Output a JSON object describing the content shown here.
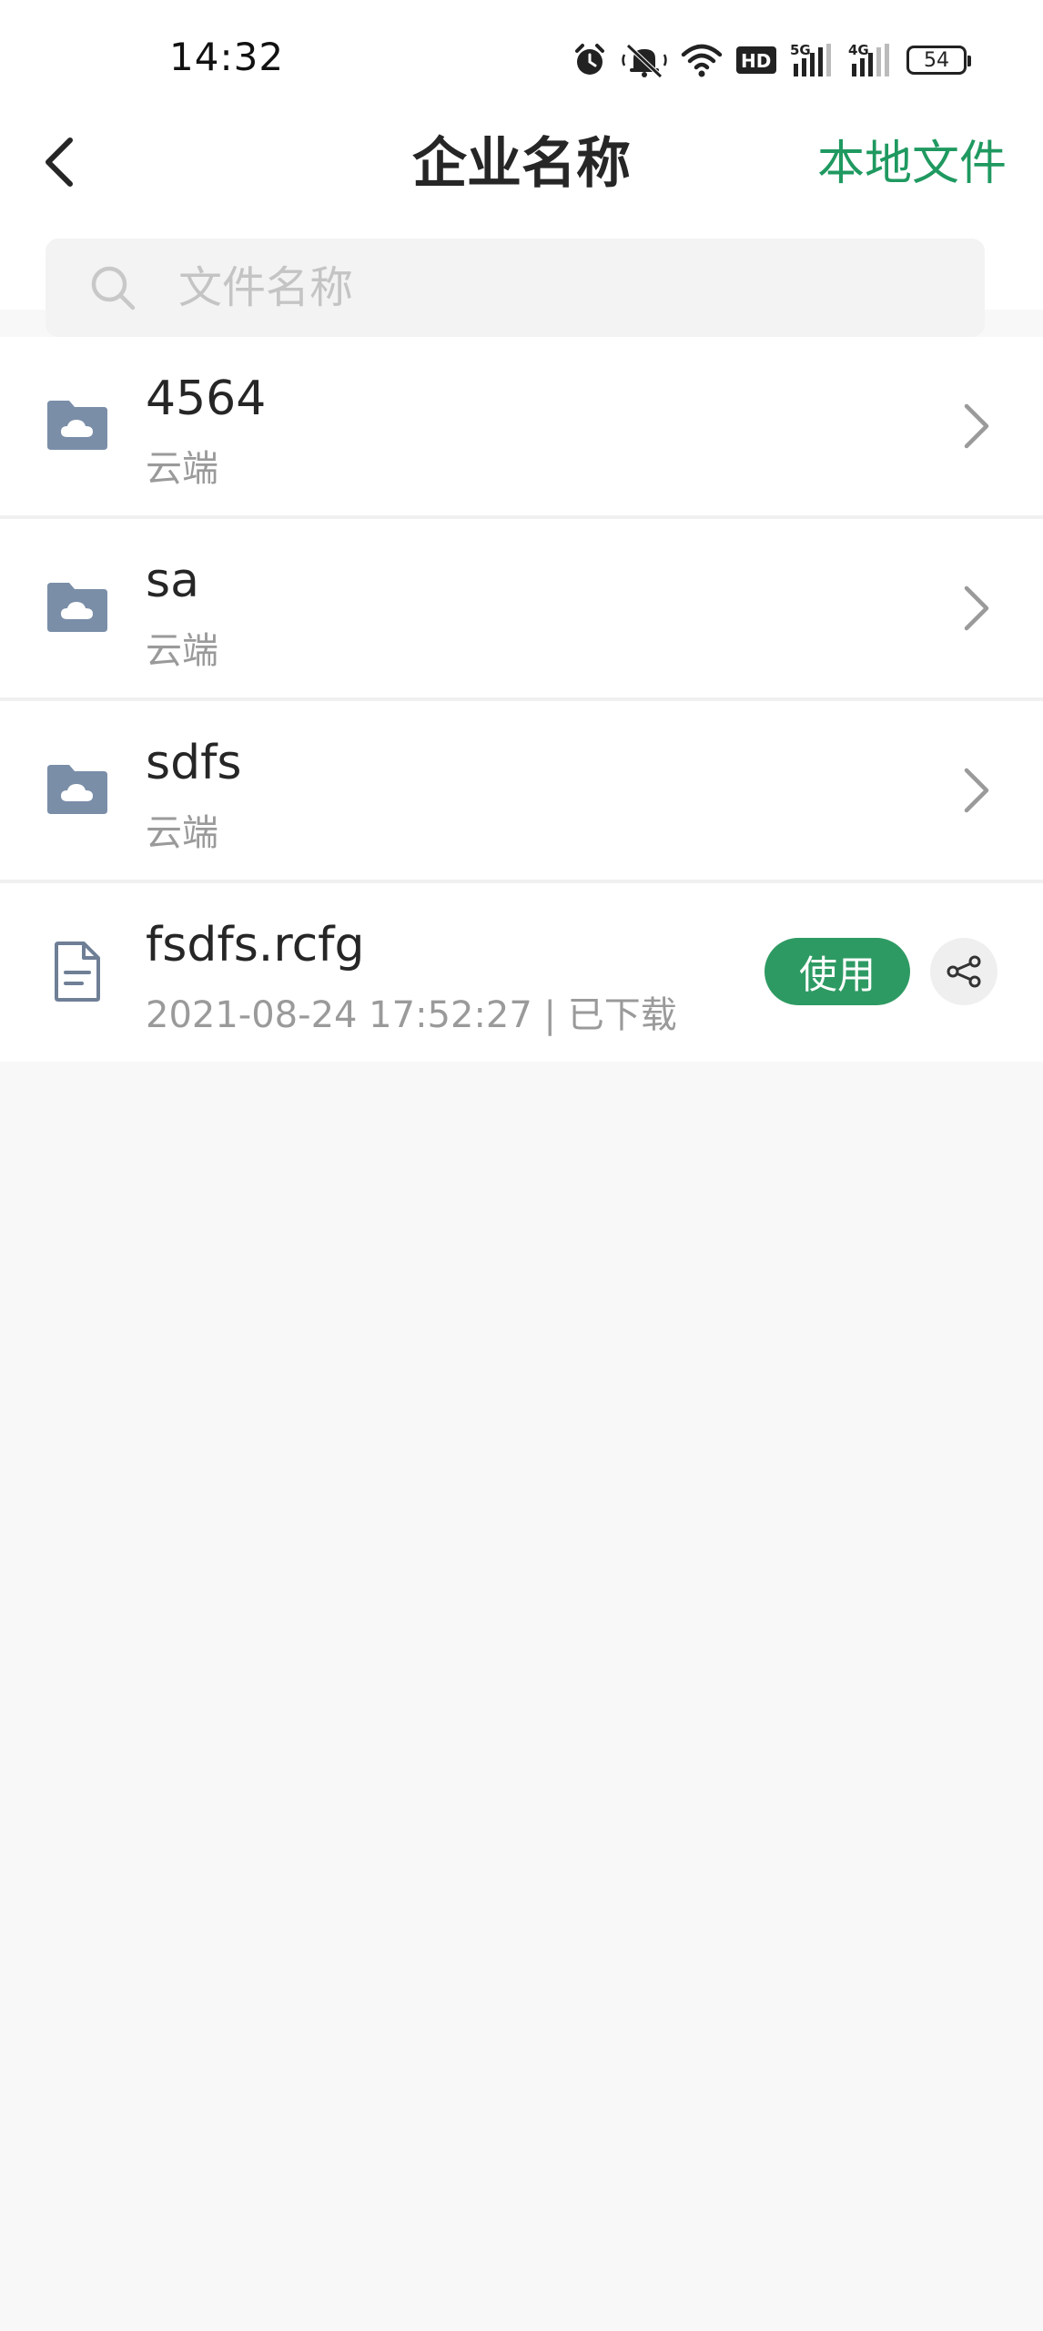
{
  "status_bar": {
    "time": "14:32",
    "icons": [
      "alarm-icon",
      "mute-icon",
      "wifi-icon",
      "hd-icon",
      "signal-5g-icon",
      "signal-4g-icon"
    ],
    "hd_label": "HD",
    "signal_5g_label": "5G",
    "signal_4g_label": "4G",
    "battery": "54"
  },
  "header": {
    "title": "企业名称",
    "local_files_label": "本地文件",
    "back_icon": "chevron-left-icon"
  },
  "search": {
    "placeholder": "文件名称",
    "value": ""
  },
  "colors": {
    "accent": "#1f9960",
    "use_button": "#2e9a63",
    "folder_icon": "#7a8ea8",
    "background": "#f8f8f8"
  },
  "items": [
    {
      "type": "folder",
      "name": "4564",
      "subtitle": "云端",
      "icon": "cloud-folder-icon"
    },
    {
      "type": "folder",
      "name": "sa",
      "subtitle": "云端",
      "icon": "cloud-folder-icon"
    },
    {
      "type": "folder",
      "name": "sdfs",
      "subtitle": "云端",
      "icon": "cloud-folder-icon"
    },
    {
      "type": "file",
      "name": "fsdfs.rcfg",
      "subtitle": "2021-08-24 17:52:27 | 已下载",
      "icon": "document-icon",
      "use_label": "使用",
      "share_icon": "share-icon"
    }
  ]
}
